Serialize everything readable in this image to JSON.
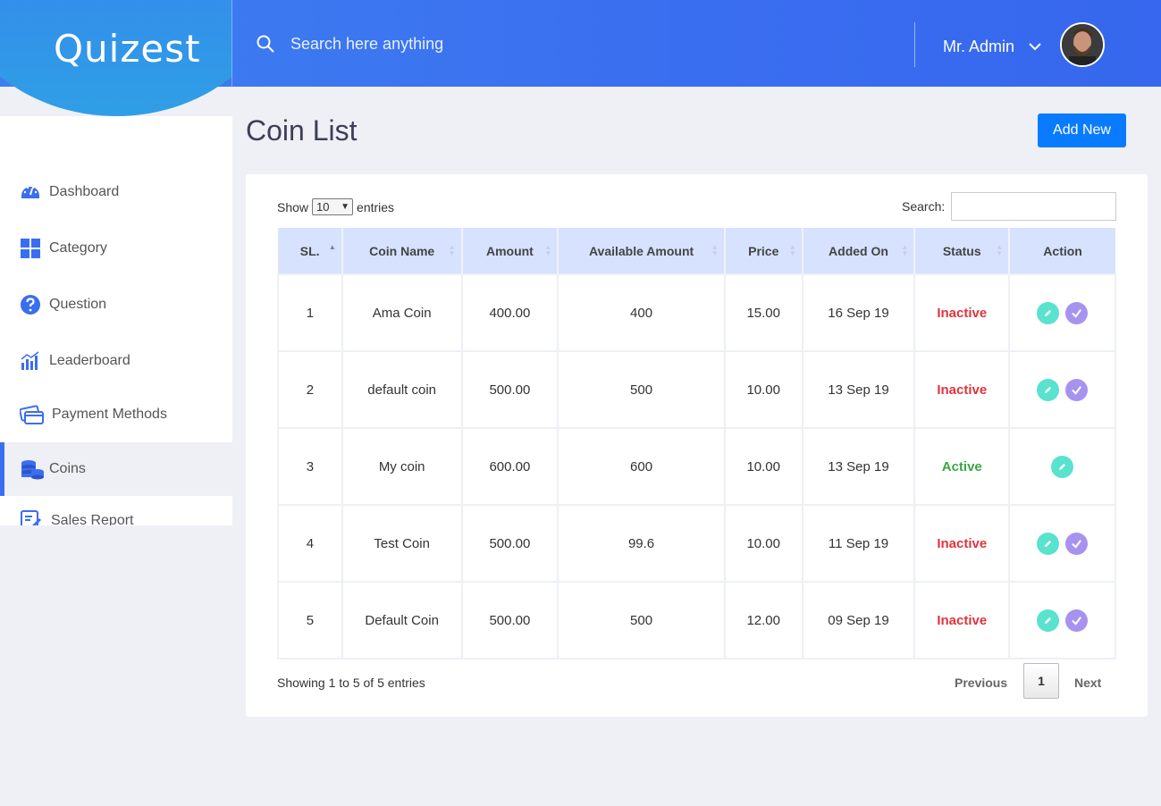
{
  "header": {
    "logo": "Quizest",
    "search_placeholder": "Search here anything",
    "user_name": "Mr. Admin"
  },
  "sidebar": {
    "items": [
      {
        "label": "Dashboard",
        "icon": "dashboard-gauge-icon"
      },
      {
        "label": "Category",
        "icon": "grid-icon"
      },
      {
        "label": "Question",
        "icon": "question-circle-icon"
      },
      {
        "label": "Leaderboard",
        "icon": "bar-chart-icon"
      },
      {
        "label": "Payment Methods",
        "icon": "credit-card-icon"
      },
      {
        "label": "Coins",
        "icon": "coins-stack-icon",
        "active": true
      },
      {
        "label": "Sales Report",
        "icon": "report-edit-icon"
      }
    ]
  },
  "main": {
    "title": "Coin List",
    "add_button": "Add New",
    "show_label": "Show",
    "entries_value": "10",
    "entries_label": "entries",
    "search_label": "Search:",
    "columns": [
      "SL.",
      "Coin Name",
      "Amount",
      "Available Amount",
      "Price",
      "Added On",
      "Status",
      "Action"
    ],
    "rows": [
      {
        "sl": "1",
        "name": "Ama Coin",
        "amount": "400.00",
        "available": "400",
        "price": "15.00",
        "added": "16 Sep 19",
        "status": "Inactive",
        "actions": [
          "edit",
          "activate"
        ]
      },
      {
        "sl": "2",
        "name": "default coin",
        "amount": "500.00",
        "available": "500",
        "price": "10.00",
        "added": "13 Sep 19",
        "status": "Inactive",
        "actions": [
          "edit",
          "activate"
        ]
      },
      {
        "sl": "3",
        "name": "My coin",
        "amount": "600.00",
        "available": "600",
        "price": "10.00",
        "added": "13 Sep 19",
        "status": "Active",
        "actions": [
          "edit"
        ]
      },
      {
        "sl": "4",
        "name": "Test Coin",
        "amount": "500.00",
        "available": "99.6",
        "price": "10.00",
        "added": "11 Sep 19",
        "status": "Inactive",
        "actions": [
          "edit",
          "activate"
        ]
      },
      {
        "sl": "5",
        "name": "Default Coin",
        "amount": "500.00",
        "available": "500",
        "price": "12.00",
        "added": "09 Sep 19",
        "status": "Inactive",
        "actions": [
          "edit",
          "activate"
        ]
      }
    ],
    "info": "Showing 1 to 5 of 5 entries",
    "pagination": {
      "previous": "Previous",
      "page": "1",
      "next": "Next"
    }
  },
  "colors": {
    "accent": "#3a6ef0",
    "add_button": "#0a7bff",
    "inactive": "#e0343c",
    "active": "#3aa845",
    "edit_button": "#59e2cd",
    "activate_button": "#a892f0",
    "table_header": "#d6e2fe"
  }
}
